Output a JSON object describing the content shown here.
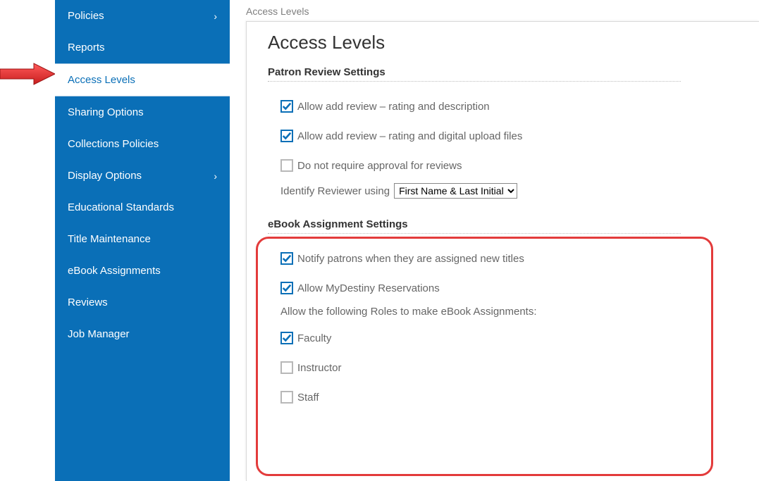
{
  "sidebar": {
    "items": [
      {
        "label": "Policies",
        "expandable": true
      },
      {
        "label": "Reports",
        "expandable": false
      },
      {
        "label": "Access Levels",
        "expandable": false,
        "active": true
      },
      {
        "label": "Sharing Options",
        "expandable": false
      },
      {
        "label": "Collections Policies",
        "expandable": false
      },
      {
        "label": "Display Options",
        "expandable": true
      },
      {
        "label": "Educational Standards",
        "expandable": false
      },
      {
        "label": "Title Maintenance",
        "expandable": false
      },
      {
        "label": "eBook Assignments",
        "expandable": false
      },
      {
        "label": "Reviews",
        "expandable": false
      },
      {
        "label": "Job Manager",
        "expandable": false
      }
    ]
  },
  "breadcrumb": "Access Levels",
  "page_title": "Access Levels",
  "patron_review": {
    "title": "Patron Review Settings",
    "allow_rating_desc": "Allow add review – rating and description",
    "allow_rating_upload": "Allow add review – rating and digital upload files",
    "no_approval": "Do not require approval for reviews",
    "identify_label": "Identify Reviewer using",
    "identify_value": "First Name & Last Initial"
  },
  "ebook": {
    "title": "eBook Assignment Settings",
    "notify": "Notify patrons when they are assigned new titles",
    "allow_mydestiny": "Allow MyDestiny Reservations",
    "roles_intro": "Allow the following Roles to make eBook Assignments:",
    "role_faculty": "Faculty",
    "role_instructor": "Instructor",
    "role_staff": "Staff"
  }
}
